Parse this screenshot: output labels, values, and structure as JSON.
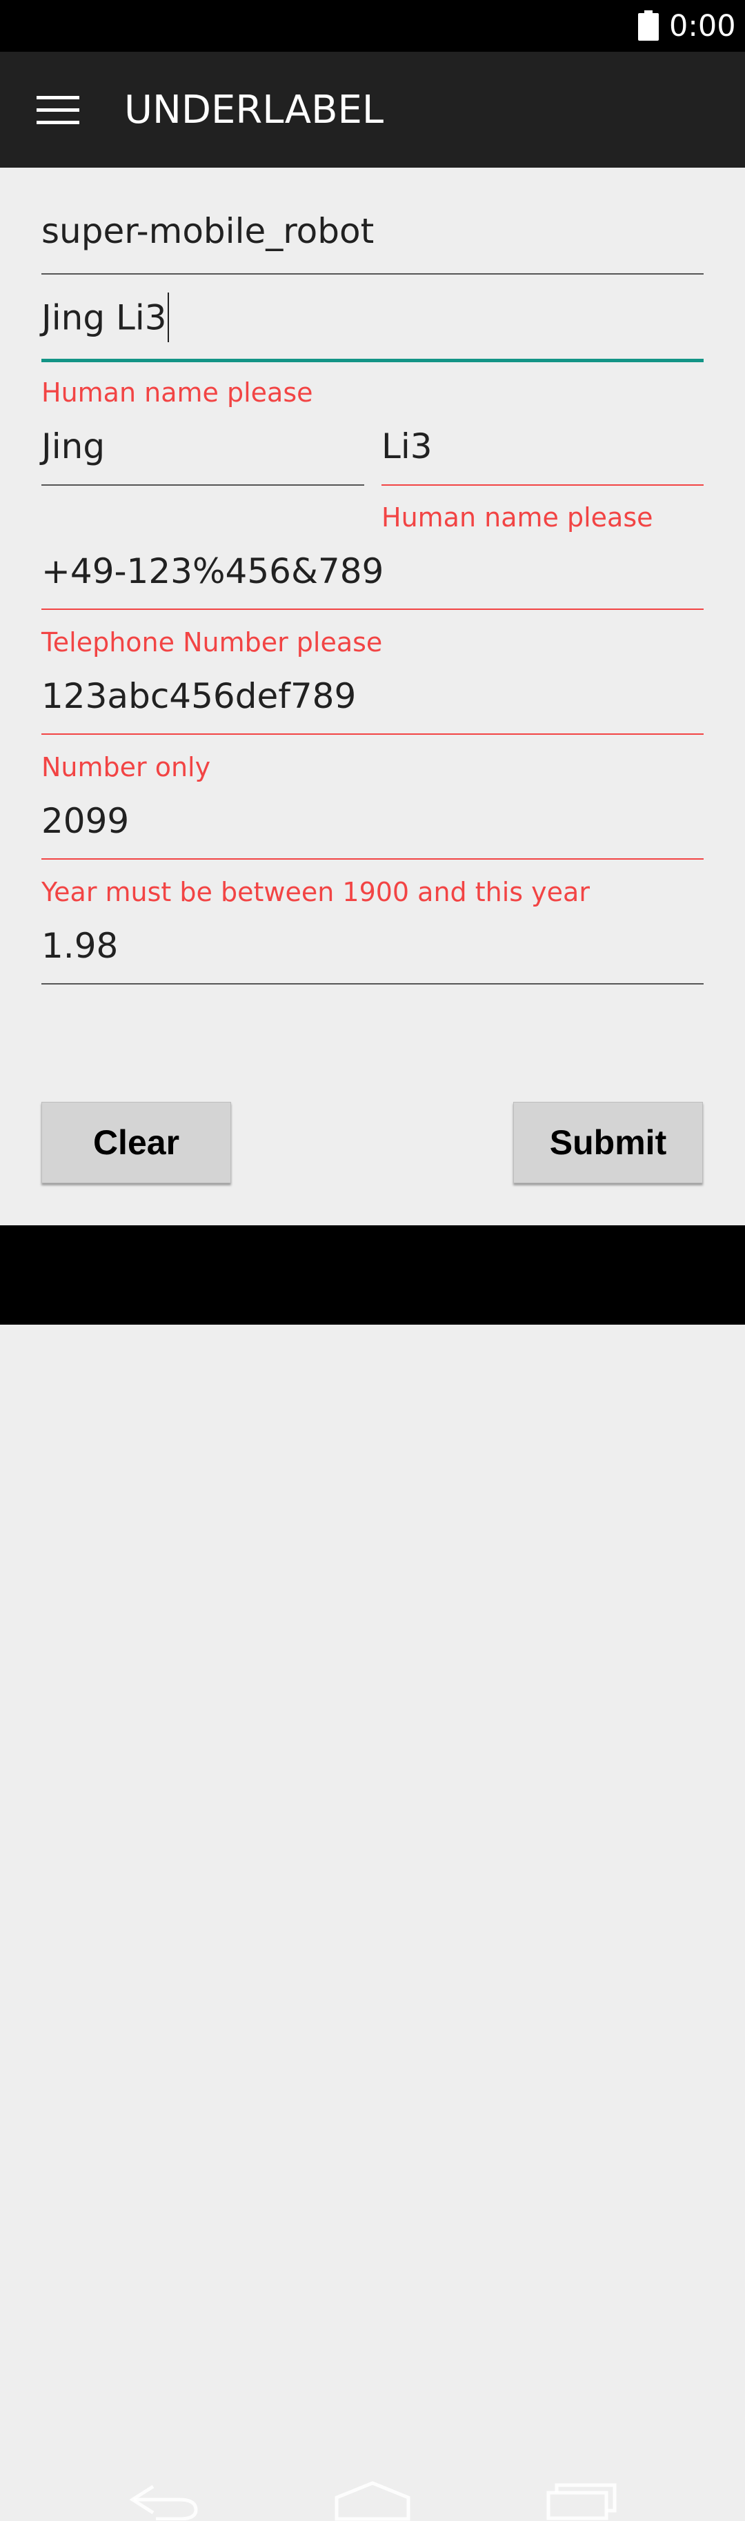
{
  "status_bar": {
    "time": "0:00",
    "battery_icon": "battery-full-icon"
  },
  "app_bar": {
    "menu_icon": "hamburger-menu-icon",
    "title": "UNDERLABEL"
  },
  "form": {
    "username": {
      "value": "super-mobile_robot"
    },
    "full_name": {
      "value": "Jing Li3",
      "error": "Human name please"
    },
    "first_name": {
      "value": "Jing"
    },
    "last_name": {
      "value": "Li3",
      "error": "Human name please"
    },
    "telephone": {
      "value": "+49-123%456&789",
      "error": "Telephone Number please"
    },
    "number": {
      "value": "123abc456def789",
      "error": "Number only"
    },
    "year": {
      "value": "2099",
      "error": "Year must be between 1900 and this year"
    },
    "decimal": {
      "value": "1.98"
    }
  },
  "buttons": {
    "clear_label": "Clear",
    "submit_label": "Submit"
  },
  "nav_bar": {
    "back_icon": "back-icon",
    "home_icon": "home-icon",
    "recents_icon": "recents-icon"
  },
  "colors": {
    "accent": "#139486",
    "error": "#f24444",
    "app_bar": "#212121",
    "background": "#eeeeee"
  }
}
